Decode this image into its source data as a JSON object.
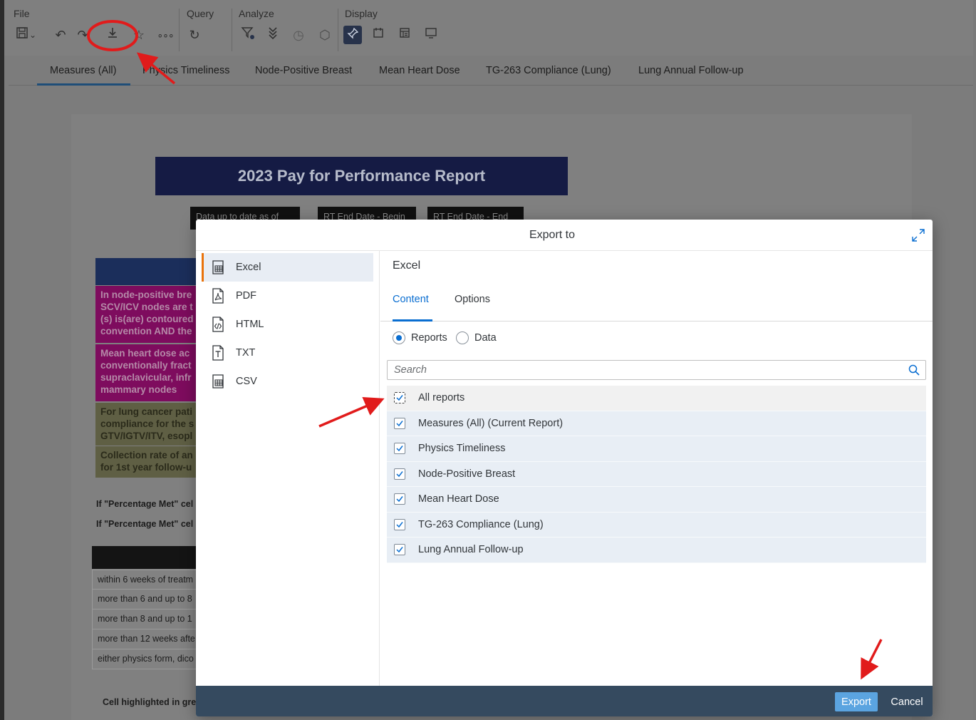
{
  "toolbar": {
    "groups": {
      "file": "File",
      "query": "Query",
      "analyze": "Analyze",
      "display": "Display"
    },
    "icons": [
      "save-icon",
      "chevron-down-icon",
      "undo-icon",
      "redo-icon",
      "download-icon",
      "favorite-icon",
      "more-icon",
      "refresh-icon",
      "filter-icon",
      "drill-icon",
      "history-icon",
      "cube-icon",
      "pin-icon",
      "panel-icon",
      "outline-icon",
      "screen-icon"
    ]
  },
  "tabs": [
    "Measures (All)",
    "Physics Timeliness",
    "Node-Positive Breast",
    "Mean Heart Dose",
    "TG-263 Compliance (Lung)",
    "Lung Annual Follow-up"
  ],
  "report": {
    "title": "2023 Pay for Performance Report",
    "header_cells": [
      "Data up to date as of",
      "RT End Date - Begin",
      "RT End Date - End"
    ],
    "measures": [
      [
        "In node-positive bre",
        "SCV/ICV nodes are t",
        "(s) is(are) contoured",
        "convention AND the"
      ],
      [
        "Mean heart dose ac",
        "conventionally fract",
        "supraclavicular, infr",
        "mammary nodes"
      ],
      [
        "For lung cancer pati",
        "compliance for the s",
        "GTV/IGTV/ITV, esopl"
      ],
      [
        "Collection rate of an",
        "for 1st year follow-u"
      ]
    ],
    "notes": [
      "If \"Percentage Met\" cel",
      "If \"Percentage Met\" cel"
    ],
    "time_rows": [
      "within 6 weeks of treatm",
      "more than 6 and up to 8",
      "more than 8 and up to 1",
      "more than 12 weeks afte",
      "either physics form, dico"
    ],
    "footnote": "Cell highlighted in gre"
  },
  "dialog": {
    "title": "Export to",
    "formats": [
      {
        "label": "Excel",
        "icon": "excel-icon",
        "selected": true
      },
      {
        "label": "PDF",
        "icon": "pdf-icon",
        "selected": false
      },
      {
        "label": "HTML",
        "icon": "html-icon",
        "selected": false
      },
      {
        "label": "TXT",
        "icon": "txt-icon",
        "selected": false
      },
      {
        "label": "CSV",
        "icon": "csv-icon",
        "selected": false
      }
    ],
    "settings_title": "Excel",
    "settings_tabs": [
      "Content",
      "Options"
    ],
    "active_settings_tab": "Content",
    "radio_options": [
      {
        "label": "Reports",
        "selected": true
      },
      {
        "label": "Data",
        "selected": false
      }
    ],
    "search_placeholder": "Search",
    "reports": [
      {
        "label": "All reports",
        "checked": true
      },
      {
        "label": "Measures (All) (Current Report)",
        "checked": true
      },
      {
        "label": "Physics Timeliness",
        "checked": true
      },
      {
        "label": "Node-Positive Breast",
        "checked": true
      },
      {
        "label": "Mean Heart Dose",
        "checked": true
      },
      {
        "label": "TG-263 Compliance (Lung)",
        "checked": true
      },
      {
        "label": "Lung Annual Follow-up",
        "checked": true
      }
    ],
    "export_label": "Export",
    "cancel_label": "Cancel"
  },
  "colors": {
    "accent": "#0a6ed1",
    "selection_marker": "#e9730c",
    "footer": "#354a5f",
    "primary_button": "#5ba4e0",
    "annotation_red": "#e11b1b"
  }
}
